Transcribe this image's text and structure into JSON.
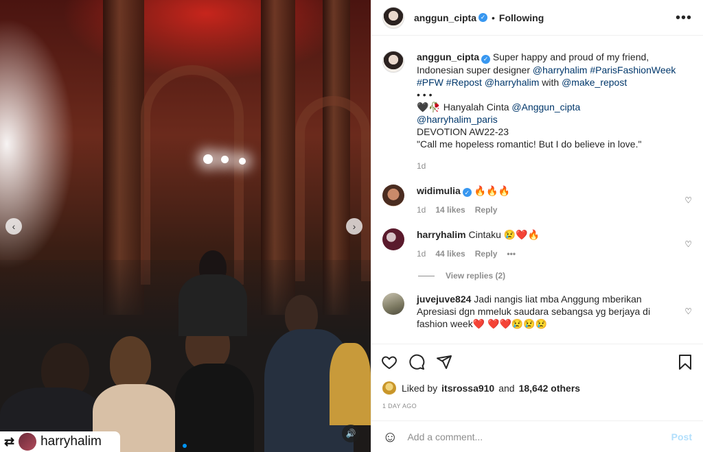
{
  "media": {
    "repost_user": "harryhalim",
    "prev_icon": "chevron-left-icon",
    "next_icon": "chevron-right-icon",
    "sound_icon": "speaker-icon"
  },
  "header": {
    "username": "anggun_cipta",
    "separator": "•",
    "follow_status": "Following",
    "more_icon": "more-horizontal-icon"
  },
  "caption": {
    "username": "anggun_cipta",
    "text_1": "Super happy and proud of my friend, Indonesian super designer",
    "mention_1": "@harryhalim",
    "hashtags": "#ParisFashionWeek #PFW #Repost",
    "mention_2": "@harryhalim",
    "with": "with",
    "mention_3": "@make_repost",
    "dots": "• • •",
    "emoji_line_prefix": "🖤🥀",
    "line_2": "Hanyalah Cinta",
    "mention_4": "@Anggun_cipta",
    "mention_5": "@harryhalim_paris",
    "line_3": "DEVOTION AW22-23",
    "line_4": "\"Call me hopeless romantic! But I do believe in love.\"",
    "time": "1d"
  },
  "comments": [
    {
      "username": "widimulia",
      "verified": true,
      "text": "🔥🔥🔥",
      "time": "1d",
      "likes": "14 likes",
      "reply": "Reply"
    },
    {
      "username": "harryhalim",
      "verified": false,
      "text": "Cintaku 😢❤️🔥",
      "time": "1d",
      "likes": "44 likes",
      "reply": "Reply",
      "more": "•••",
      "view_replies": "View replies (2)"
    },
    {
      "username": "juvejuve824",
      "verified": false,
      "text": "Jadi nangis liat mba Anggung mberikan Apresiasi dgn mmeluk saudara sebangsa yg berjaya di fashion week❤️ ❤️❤️😢😢😢"
    }
  ],
  "likes": {
    "prefix": "Liked by",
    "user": "itsrossa910",
    "and": "and",
    "others": "18,642 others"
  },
  "date": "1 DAY AGO",
  "comment_box": {
    "placeholder": "Add a comment...",
    "post_label": "Post",
    "emoji_icon": "smile-icon"
  },
  "colors": {
    "link": "#00376b",
    "verified": "#3897f0",
    "muted": "#8e8e8e",
    "post_disabled": "#b2dffc",
    "indicator": "#0095f6"
  }
}
